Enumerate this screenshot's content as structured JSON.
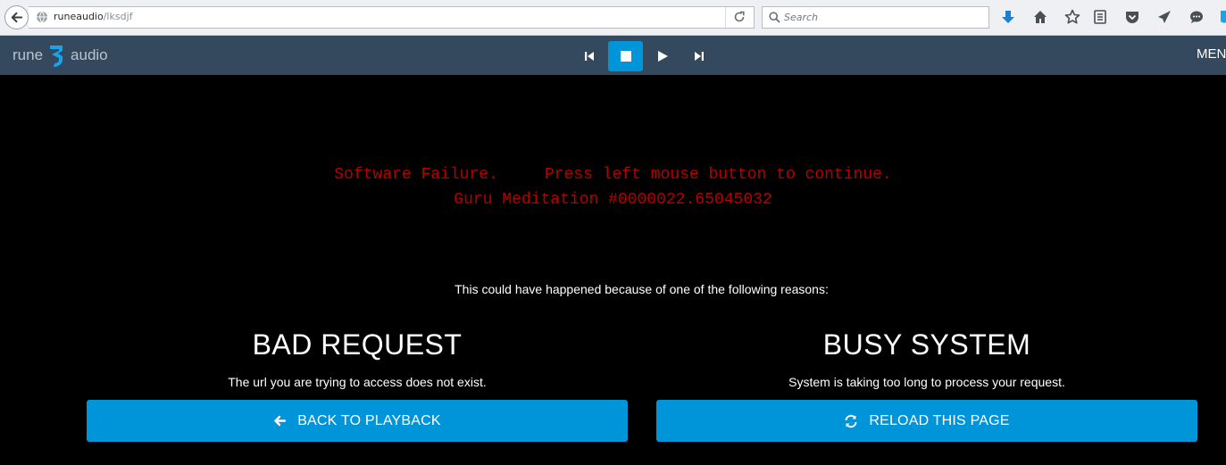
{
  "browser": {
    "url_host": "runeaudio",
    "url_path": "/lksdjf",
    "search_placeholder": "Search",
    "icons": [
      "back-icon",
      "globe-icon",
      "reload-icon",
      "search-icon",
      "download-icon",
      "home-icon",
      "bookmark-star-icon",
      "reader-icon",
      "pocket-icon",
      "send-icon",
      "chat-icon",
      "firefox-shield-icon"
    ]
  },
  "header": {
    "logo_left": "rune",
    "logo_right": "audio",
    "menu_label": "MENU",
    "transport": [
      "previous-icon",
      "stop-icon",
      "play-icon",
      "next-icon"
    ],
    "active_control": "stop",
    "accent": "#0095d8",
    "bar_color": "#34495e"
  },
  "error": {
    "line1_a": "Software Failure.",
    "line1_b": "Press left mouse button to continue.",
    "line2": "Guru Meditation #0000022.65045032",
    "color": "#b50000"
  },
  "main": {
    "reasons_text": "This could have happened because of one of the following reasons:",
    "left": {
      "title": "BAD REQUEST",
      "description": "The url you are trying to access does not exist.",
      "button_label": "BACK TO PLAYBACK",
      "button_icon": "arrow-left-icon"
    },
    "right": {
      "title": "BUSY SYSTEM",
      "description": "System is taking too long to process your request.",
      "button_label": "RELOAD THIS PAGE",
      "button_icon": "refresh-icon"
    }
  }
}
